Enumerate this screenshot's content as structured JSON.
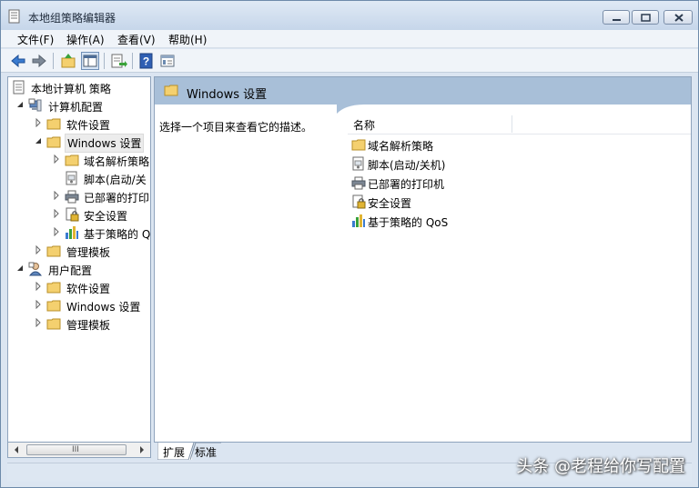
{
  "window": {
    "title": "本地组策略编辑器",
    "title_icon": "policy-document-icon"
  },
  "menubar": {
    "items": [
      {
        "label": "文件(F)"
      },
      {
        "label": "操作(A)"
      },
      {
        "label": "查看(V)"
      },
      {
        "label": "帮助(H)"
      }
    ]
  },
  "toolbar": {
    "buttons": [
      "back-arrow-icon",
      "forward-arrow-icon",
      "up-folder-icon",
      "show-hide-tree-icon",
      "export-list-icon",
      "help-icon",
      "properties-icon"
    ],
    "pressed": "show-hide-tree-icon"
  },
  "tree": {
    "root": "本地计算机 策略",
    "computer_config": "计算机配置",
    "cc_software": "软件设置",
    "cc_windows": "Windows 设置",
    "cc_win_dns": "域名解析策略",
    "cc_win_scripts": "脚本(启动/关",
    "cc_win_printers": "已部署的打印",
    "cc_win_security": "安全设置",
    "cc_win_qos": "基于策略的 Q",
    "cc_admin": "管理模板",
    "user_config": "用户配置",
    "uc_software": "软件设置",
    "uc_windows": "Windows 设置",
    "uc_admin": "管理模板"
  },
  "scrollbar": {
    "grip": "III"
  },
  "details": {
    "header_title": "Windows 设置",
    "description": "选择一个项目来查看它的描述。",
    "column_name": "名称",
    "items": [
      {
        "label": "域名解析策略",
        "icon": "folder-icon"
      },
      {
        "label": "脚本(启动/关机)",
        "icon": "script-icon"
      },
      {
        "label": "已部署的打印机",
        "icon": "printer-icon"
      },
      {
        "label": "安全设置",
        "icon": "security-icon"
      },
      {
        "label": "基于策略的 QoS",
        "icon": "bar-chart-icon"
      }
    ]
  },
  "tabs": {
    "extended": "扩展",
    "standard": "标准",
    "active": "extended"
  },
  "watermark": "头条 @老程给你写配置",
  "colors": {
    "header_band": "#a8bfd8",
    "folder": "#f4d06f",
    "window_frame": "#dbe5f1"
  }
}
